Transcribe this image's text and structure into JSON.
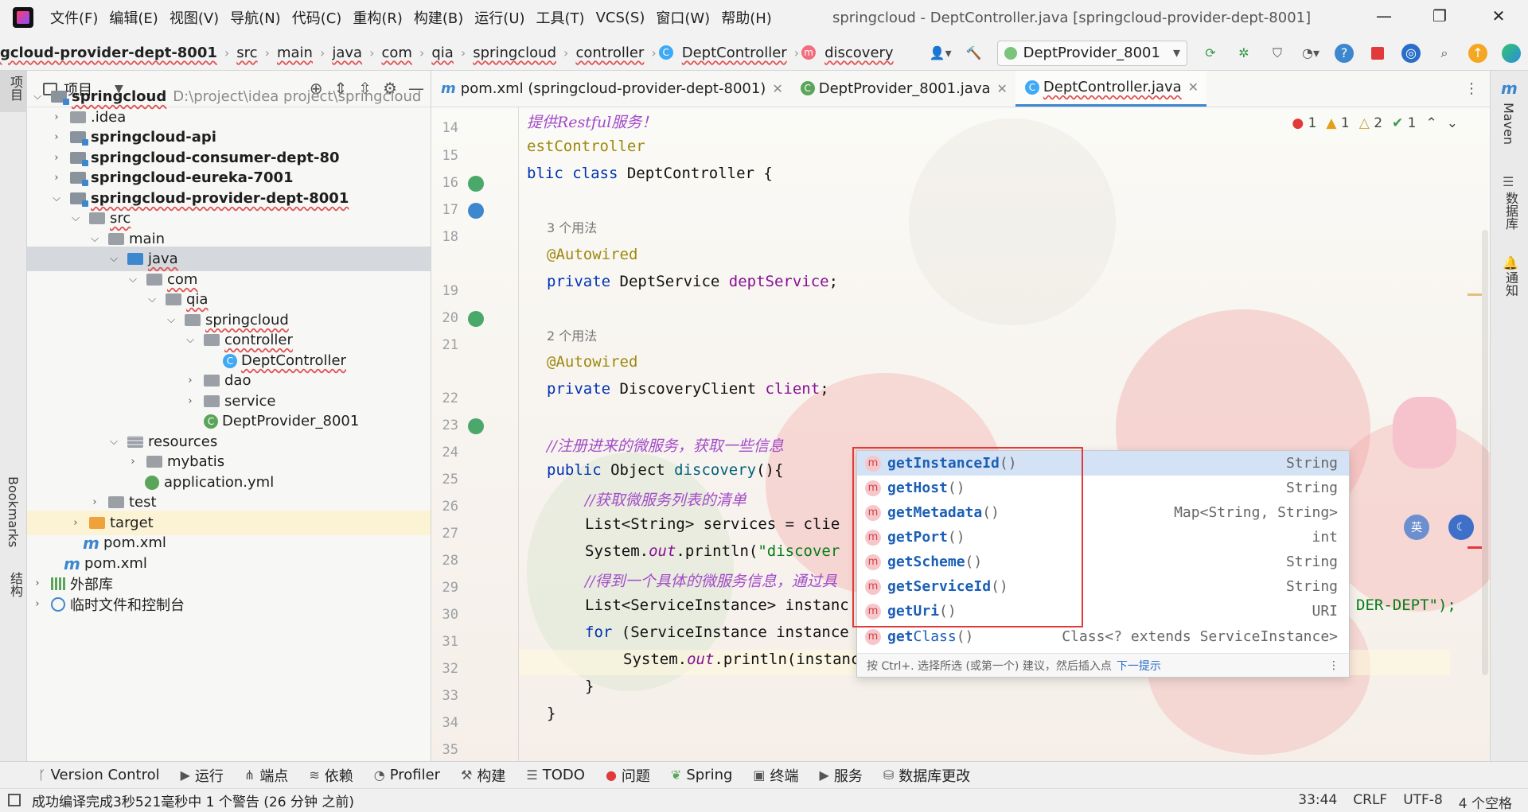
{
  "menu": {
    "items": [
      "文件(F)",
      "编辑(E)",
      "视图(V)",
      "导航(N)",
      "代码(C)",
      "重构(R)",
      "构建(B)",
      "运行(U)",
      "工具(T)",
      "VCS(S)",
      "窗口(W)",
      "帮助(H)"
    ],
    "window_title": "springcloud - DeptController.java [springcloud-provider-dept-8001]"
  },
  "breadcrumbs": [
    "gcloud-provider-dept-8001",
    "src",
    "main",
    "java",
    "com",
    "qia",
    "springcloud",
    "controller",
    "DeptController",
    "discovery"
  ],
  "run_config": "DeptProvider_8001",
  "left_strip": {
    "project": "项目",
    "bookmarks": "Bookmarks",
    "structure": "结构"
  },
  "right_strip": {
    "maven": "Maven",
    "database": "数据库",
    "notifications": "通知"
  },
  "project_panel": {
    "title": "项目",
    "root_name": "springcloud",
    "root_path": "D:\\project\\idea project\\springcloud",
    "items": [
      "springcloud",
      ".idea",
      "springcloud-api",
      "springcloud-consumer-dept-80",
      "springcloud-eureka-7001",
      "springcloud-provider-dept-8001",
      "src",
      "main",
      "java",
      "com",
      "qia",
      "springcloud",
      "controller",
      "DeptController",
      "dao",
      "service",
      "DeptProvider_8001",
      "resources",
      "mybatis",
      "application.yml",
      "test",
      "target",
      "pom.xml",
      "pom.xml",
      "外部库",
      "临时文件和控制台"
    ]
  },
  "tabs": [
    {
      "label": "pom.xml (springcloud-provider-dept-8001)"
    },
    {
      "label": "DeptProvider_8001.java"
    },
    {
      "label": "DeptController.java"
    }
  ],
  "inspections": {
    "errors": "1",
    "warnings": "1",
    "weak_warnings": "2",
    "typos": "1"
  },
  "line_numbers": [
    "14",
    "15",
    "16",
    "17",
    "18",
    "",
    "19",
    "20",
    "21",
    "",
    "22",
    "23",
    "24",
    "25",
    "26",
    "27",
    "28",
    "29",
    "30",
    "31",
    "32",
    "33",
    "34",
    "35"
  ],
  "code": {
    "l15_comment": "提供Restful服务！",
    "l16_ann": "estController",
    "l17_kw": "blic class",
    "l17_rest": " DeptController {",
    "usage3": "3 个用法",
    "l19_ann": "@Autowired",
    "l20_kw": "private",
    "l20_type": " DeptService ",
    "l20_field": "deptService",
    "l20_end": ";",
    "usage2": "2 个用法",
    "l22_ann": "@Autowired",
    "l23_kw": "private",
    "l23_type": " DiscoveryClient ",
    "l23_field": "client",
    "l23_end": ";",
    "l25_comment": "//注册进来的微服务，获取一些信息",
    "l26_kw": "public",
    "l26_rest": " Object ",
    "l26_method": "discovery",
    "l26_end": "(){",
    "l27_comment": "//获取微服务列表的清单",
    "l28_text": "List<String> services = clie",
    "l29_pre": "System.",
    "l29_out": "out",
    "l29_mid": ".println(",
    "l29_str": "\"discover",
    "l30_comment": "//得到一个具体的微服务信息，通过具",
    "l31_text": "List<ServiceInstance> instanc",
    "l31_tail": "DER-DEPT\");",
    "l32_kw": "for",
    "l32_rest": " (ServiceInstance instance",
    "l33_pre": "System.",
    "l33_out": "out",
    "l33_mid": ".println(instance.get",
    "l33_end": ");",
    "l34": "}",
    "l35": "}"
  },
  "completion": {
    "items": [
      {
        "match": "get",
        "rest": "InstanceId",
        "params": "()",
        "type": "String"
      },
      {
        "match": "get",
        "rest": "Host",
        "params": "()",
        "type": "String"
      },
      {
        "match": "get",
        "rest": "Metadata",
        "params": "()",
        "type": "Map<String, String>"
      },
      {
        "match": "get",
        "rest": "Port",
        "params": "()",
        "type": "int"
      },
      {
        "match": "get",
        "rest": "Scheme",
        "params": "()",
        "type": "String"
      },
      {
        "match": "get",
        "rest": "ServiceId",
        "params": "()",
        "type": "String"
      },
      {
        "match": "get",
        "rest": "Uri",
        "params": "()",
        "type": "URI"
      },
      {
        "match": "get",
        "rest": "Class",
        "params": "()",
        "type": "Class<? extends ServiceInstance>"
      }
    ],
    "footer": "按 Ctrl+. 选择所选 (或第一个) 建议，然后插入点",
    "footer_link": "下一提示"
  },
  "tool_windows": [
    "Version Control",
    "运行",
    "端点",
    "依赖",
    "Profiler",
    "构建",
    "TODO",
    "问题",
    "Spring",
    "终端",
    "服务",
    "数据库更改"
  ],
  "status": {
    "message": "成功编译完成3秒521毫秒中 1 个警告 (26 分钟 之前)",
    "position": "33:44",
    "line_sep": "CRLF",
    "encoding": "UTF-8",
    "indent": "4 个空格"
  },
  "colors": {
    "accent": "#3d87cf",
    "error": "#e23a3a",
    "selection": "#d4e2f5"
  }
}
